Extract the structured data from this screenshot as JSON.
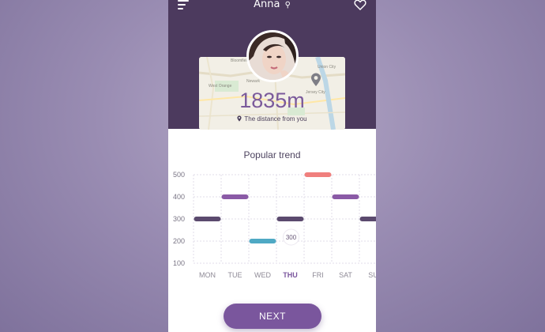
{
  "header": {
    "title": "Anna",
    "menu_icon": "menu-icon",
    "title_icon": "key-icon",
    "favorite_icon": "heart-icon"
  },
  "profile": {
    "distance": "1835m",
    "distance_caption": "The distance from you",
    "map_labels": [
      "Bloomfield",
      "West Orange",
      "Newark",
      "Jersey City",
      "Union City"
    ],
    "pin_icon": "map-pin-icon"
  },
  "chart_data": {
    "type": "bar",
    "title": "Popular trend",
    "categories": [
      "MON",
      "TUE",
      "WED",
      "THU",
      "FRI",
      "SAT",
      "SUN"
    ],
    "category_display": [
      "MON",
      "TUE",
      "WED",
      "THU",
      "FRI",
      "SAT",
      "SU"
    ],
    "values": [
      300,
      400,
      200,
      300,
      500,
      400,
      300
    ],
    "ylim": [
      100,
      500
    ],
    "yticks": [
      500,
      400,
      300,
      200,
      100
    ],
    "selected_category": "THU",
    "tooltip_value": "300",
    "grid": true,
    "bar_colors": [
      "#5b4a6e",
      "#8a5aa6",
      "#4fa9c4",
      "#5b4a6e",
      "#f07f7d",
      "#8a5aa6",
      "#5b4a6e"
    ]
  },
  "actions": {
    "next_label": "NEXT"
  },
  "colors": {
    "header_bg": "#4c3a5e",
    "accent": "#7a569d",
    "distance_text": "#7b5a9b"
  }
}
